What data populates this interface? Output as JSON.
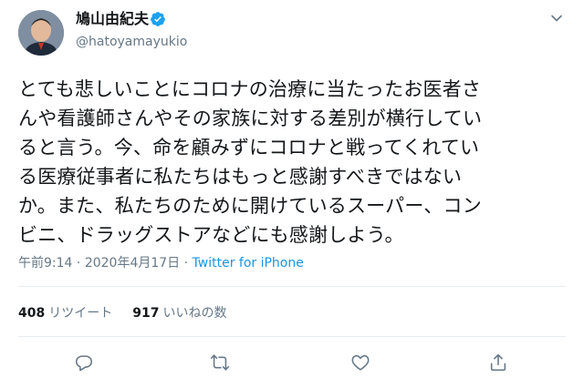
{
  "user": {
    "display_name": "鳩山由紀夫",
    "handle": "@hatoyamayukio"
  },
  "tweet": {
    "lines": [
      "とても悲しいことにコロナの治療に当たったお医者さ",
      "んや看護師さんやその家族に対する差別が横行してい",
      "ると言う。今、命を顧みずにコロナと戦ってくれてい",
      "る医療従事者に私たちはもっと感謝すべきではない",
      "か。また、私たちのために開けているスーパー、コン",
      "ビニ、ドラッグストアなどにも感謝しよう。"
    ]
  },
  "meta": {
    "time": "午前9:14",
    "separator": " · ",
    "date": "2020年4月17日",
    "separator2": " · ",
    "source": "Twitter for iPhone"
  },
  "stats": {
    "retweet_count": "408",
    "retweet_label": "リツイート",
    "like_count": "917",
    "like_label": "いいねの数"
  },
  "icons": {
    "verified": "verified-badge-icon",
    "more": "chevron-down-icon",
    "reply": "reply-icon",
    "retweet": "retweet-icon",
    "like": "heart-icon",
    "share": "share-icon"
  },
  "colors": {
    "accent": "#1da1f2",
    "link": "#1b95e0",
    "secondary_text": "#657786",
    "icon": "#657786"
  }
}
